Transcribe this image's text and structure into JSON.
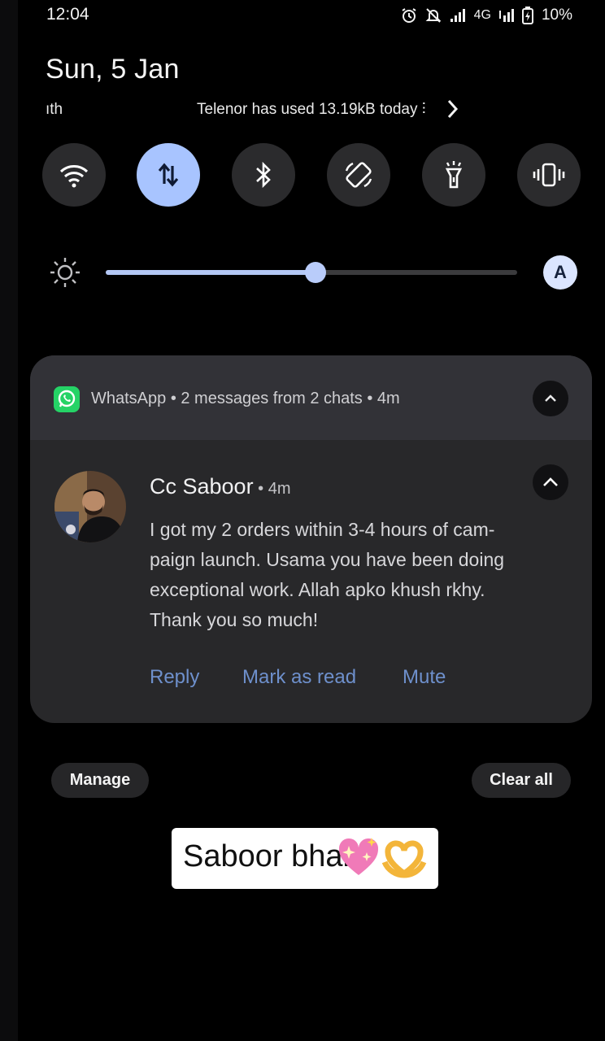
{
  "status_bar": {
    "time": "12:04",
    "network_type": "4G",
    "battery_percent": "10%"
  },
  "header": {
    "date": "Sun, 5 Jan",
    "ticker_left": "ıth",
    "ticker_text": "Telenor has used 13.19kB today ⫶"
  },
  "quick_settings": [
    {
      "name": "wifi",
      "icon": "wifi-icon",
      "active": false
    },
    {
      "name": "mobile-data",
      "icon": "arrows-up-down-icon",
      "active": true
    },
    {
      "name": "bluetooth",
      "icon": "bluetooth-icon",
      "active": false
    },
    {
      "name": "auto-rotate",
      "icon": "rotate-icon",
      "active": false
    },
    {
      "name": "flashlight",
      "icon": "flashlight-icon",
      "active": false
    },
    {
      "name": "vibrate",
      "icon": "vibrate-icon",
      "active": false
    }
  ],
  "brightness": {
    "level_percent": 51,
    "auto_label": "A"
  },
  "notification": {
    "app_summary": "WhatsApp • 2 messages from 2 chats • 4m",
    "sender": "Cc Saboor",
    "sender_time": " • 4m",
    "message": "I got my 2 orders within 3-4 hours of cam-\npaign launch. Usama you have  been doing\nexceptional work. Allah apko khush rkhy.\nThank you so much!",
    "actions": {
      "reply": "Reply",
      "mark_read": "Mark as read",
      "mute": "Mute"
    },
    "accent_color": "#6e90cc",
    "app_color": "#25d366"
  },
  "footer": {
    "manage": "Manage",
    "clear_all": "Clear all"
  },
  "sticker": {
    "text": "Saboor bhai"
  }
}
